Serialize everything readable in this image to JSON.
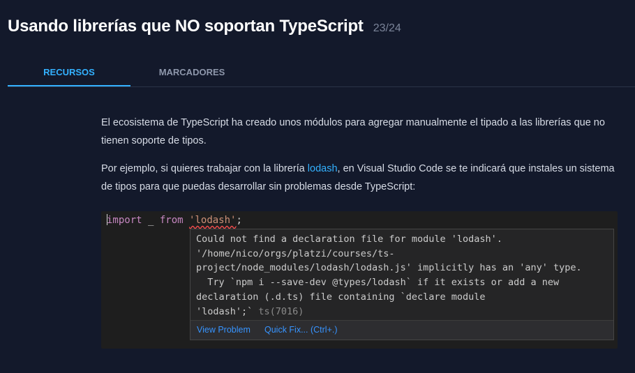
{
  "header": {
    "title": "Usando librerías que NO soportan TypeScript",
    "counter": "23/24"
  },
  "tabs": [
    {
      "label": "RECURSOS",
      "active": true
    },
    {
      "label": "MARCADORES",
      "active": false
    }
  ],
  "content": {
    "paragraph1": "El ecosistema de TypeScript ha creado unos módulos para agregar manualmente el tipado a las librerías que no tienen soporte de tipos.",
    "paragraph2_before": "Por ejemplo, si quieres trabajar con la librería ",
    "paragraph2_link": "lodash",
    "paragraph2_after": ", en Visual Studio Code se te indicará que instales un sistema de tipos para que puedas desarrollar sin problemas desde TypeScript:"
  },
  "editor": {
    "code": {
      "keyword_import": "import",
      "identifier": " _ ",
      "keyword_from": "from",
      "space": " ",
      "string": "'lodash'",
      "semicolon": ";"
    },
    "hover": {
      "message_lines": [
        "Could not find a declaration file for module 'lodash'.",
        "'/home/nico/orgs/platzi/courses/ts-",
        "project/node_modules/lodash/lodash.js' implicitly has an 'any' type.",
        "  Try `npm i --save-dev @types/lodash` if it exists or add a new",
        "declaration (.d.ts) file containing `declare module",
        "'lodash';`"
      ],
      "error_code": " ts(7016)",
      "actions": {
        "view_problem": "View Problem",
        "quick_fix": "Quick Fix... (Ctrl+.)"
      }
    }
  },
  "colors": {
    "background": "#13192b",
    "accent": "#33b1ff",
    "editor_bg": "#1e1e1e",
    "hover_bg": "#252526"
  }
}
